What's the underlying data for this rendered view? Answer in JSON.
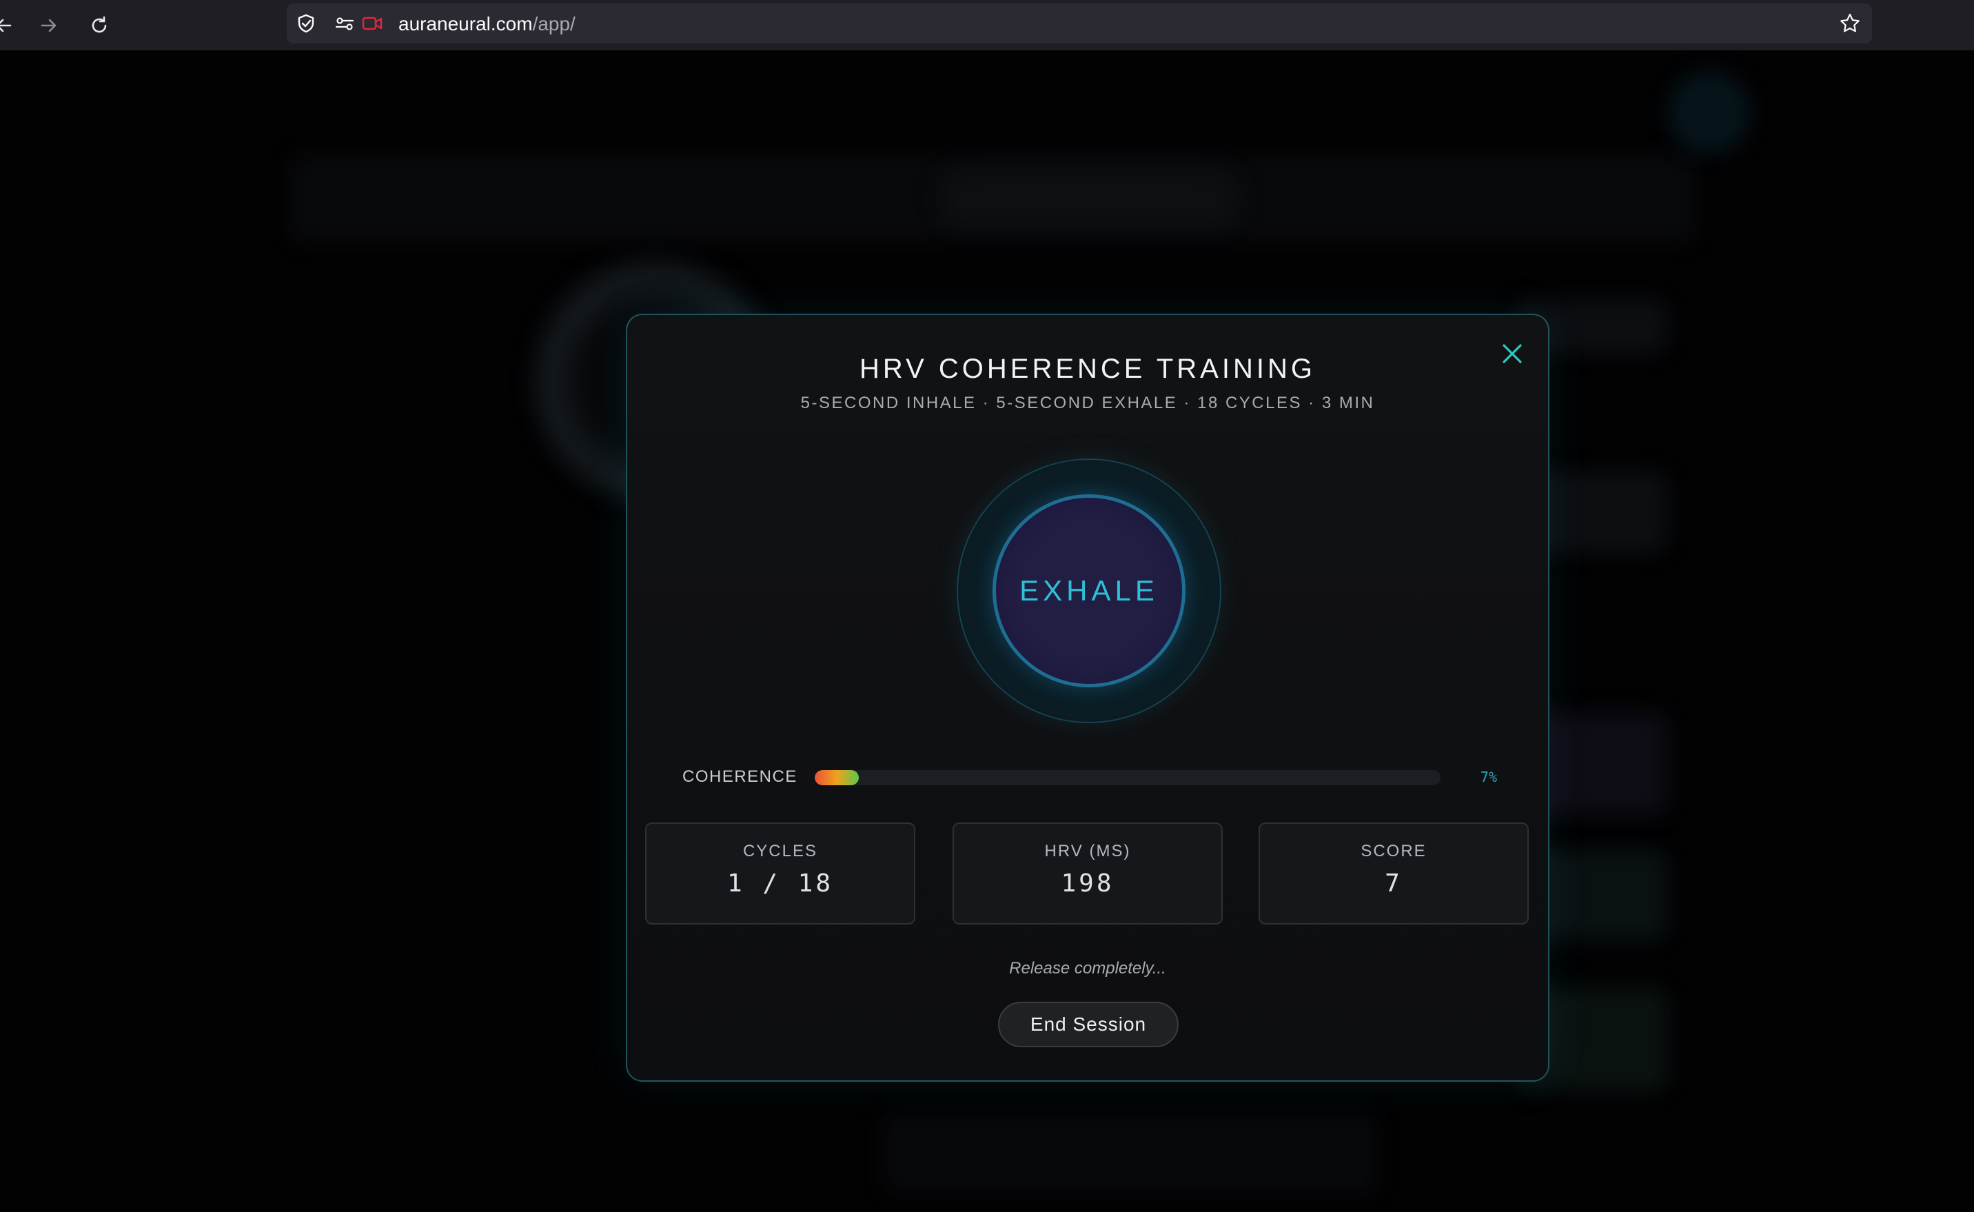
{
  "browser": {
    "url_domain": "auraneural.com",
    "url_path": "/app/",
    "back_icon": "back-arrow-icon",
    "forward_icon": "forward-arrow-icon",
    "reload_icon": "reload-icon",
    "shield_icon": "shield-icon",
    "permissions_icon": "permissions-icon",
    "camera_icon": "camera-active-icon",
    "bookmark_icon": "star-icon"
  },
  "modal": {
    "title": "HRV COHERENCE TRAINING",
    "subtitle": "5-SECOND INHALE · 5-SECOND EXHALE · 18 CYCLES · 3 MIN",
    "close_icon": "close-icon",
    "phase": "EXHALE",
    "coherence": {
      "label": "COHERENCE",
      "value_text": "7%",
      "fraction": 0.07
    },
    "stats": [
      {
        "label": "CYCLES",
        "value": "1 / 18"
      },
      {
        "label": "HRV (MS)",
        "value": "198"
      },
      {
        "label": "SCORE",
        "value": "7"
      }
    ],
    "hint": "Release completely...",
    "end_button": "End Session"
  },
  "colors": {
    "accent": "#2fc0d8",
    "modal_border": "#40c4d6",
    "breath_fill": "#221d42",
    "coherence_gradient": [
      "#e8533a",
      "#f0a21c",
      "#5cc84a"
    ]
  }
}
